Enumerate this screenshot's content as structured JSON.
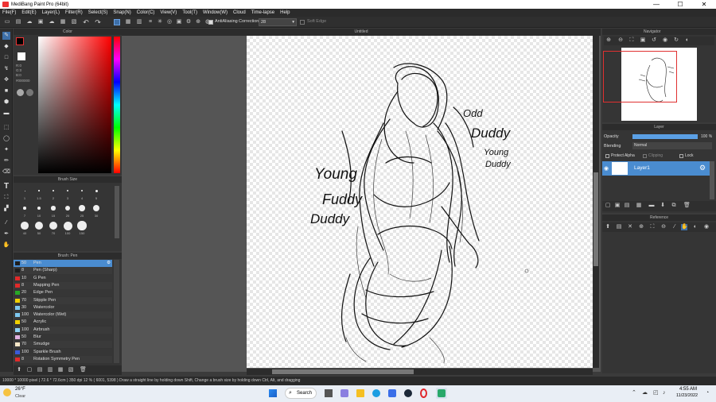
{
  "app": {
    "title": "MediBang Paint Pro (64bit)"
  },
  "window_controls": {
    "minimize": "—",
    "maximize": "☐",
    "close": "✕"
  },
  "menu": [
    "File(F)",
    "Edit(E)",
    "Layer(L)",
    "Filter(R)",
    "Select(S)",
    "Snap(N)",
    "Color(C)",
    "View(V)",
    "Tool(T)",
    "Window(W)",
    "Cloud",
    "Time-lapse",
    "Help"
  ],
  "toolbar": {
    "antialiasing": "AntiAliasing",
    "correction_label": "Correction",
    "correction_value": "28",
    "soft_edge": "Soft Edge"
  },
  "color_panel": {
    "title": "Color",
    "r": "R:0",
    "g": "G:0",
    "b": "B:0",
    "hex": "#000000",
    "main_color": "#000000",
    "sub_color": "#ffffff"
  },
  "brush_size_panel": {
    "title": "Brush Size",
    "sizes": [
      "1",
      "1.5",
      "2",
      "3",
      "4",
      "5",
      "7",
      "10",
      "15",
      "20",
      "25",
      "30",
      "40",
      "50",
      "70",
      "100",
      "150"
    ]
  },
  "brush_panel": {
    "title": "Brush: Pen",
    "items": [
      {
        "size": "50",
        "name": "Pen",
        "color": "#1e1e1e",
        "selected": true
      },
      {
        "size": "8",
        "name": "Pen (Sharp)",
        "color": "#1e1e1e"
      },
      {
        "size": "10",
        "name": "G Pen",
        "color": "#e02a2a"
      },
      {
        "size": "8",
        "name": "Mapping Pen",
        "color": "#e02a2a"
      },
      {
        "size": "20",
        "name": "Edge Pen",
        "color": "#27a827"
      },
      {
        "size": "70",
        "name": "Stipple Pen",
        "color": "#f0d000"
      },
      {
        "size": "30",
        "name": "Watercolor",
        "color": "#7ec8f0"
      },
      {
        "size": "100",
        "name": "Watercolor (Wet)",
        "color": "#7ec8f0"
      },
      {
        "size": "50",
        "name": "Acrylic",
        "color": "#f0d000"
      },
      {
        "size": "100",
        "name": "Airbrush",
        "color": "#8fd2f5"
      },
      {
        "size": "50",
        "name": "Blur",
        "color": "#e0b0e0"
      },
      {
        "size": "70",
        "name": "Smudge",
        "color": "#f5e6c8"
      },
      {
        "size": "100",
        "name": "Sparkle Brush",
        "color": "#3a5ad8"
      },
      {
        "size": "8",
        "name": "Rotation Symmetry Pen",
        "color": "#e02a2a"
      }
    ]
  },
  "canvas": {
    "title": "Untitled"
  },
  "drawing_text": {
    "t1": "Young",
    "t2": "Fuddy",
    "t3": "Duddy",
    "t4": "Odd",
    "t5": "Duddy",
    "t6": "Young",
    "t7": "Duddy"
  },
  "navigator": {
    "title": "Navigator"
  },
  "layer_panel": {
    "title": "Layer",
    "opacity_label": "Opacity",
    "opacity_value": "100 %",
    "blending_label": "Blending",
    "blending_value": "Normal",
    "protect_alpha": "Protect Alpha",
    "clipping": "Clipping",
    "lock": "Lock",
    "layer_name": "Layer1"
  },
  "reference": {
    "title": "Reference"
  },
  "status": {
    "text": "10000 * 10000 pixel   ( 72.6 * 72.6cm )   350 dpi   12 %   ( 6001, 5398 )   Draw a straight line by holding down Shift, Change a brush size by holding down Ctrl, Alt, and dragging"
  },
  "taskbar": {
    "weather_temp": "26°F",
    "weather_cond": "Clear",
    "search": "Search",
    "time": "4:55 AM",
    "date": "11/23/2022"
  }
}
